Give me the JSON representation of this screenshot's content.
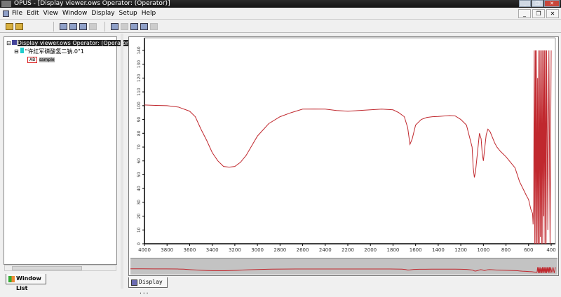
{
  "window": {
    "title": "OPUS - [Display viewer.ows     Operator:   (Operator)]"
  },
  "menu": [
    "File",
    "Edit",
    "View",
    "Window",
    "Display",
    "Setup",
    "Help"
  ],
  "tree": {
    "root": "Display viewer.ows     Operator:   (Operator)",
    "file": "\"许红军磷酸氢二钠.0\"1",
    "spectrum_label": "AB",
    "sample": "sample"
  },
  "left_tab": "Window List",
  "display_tab": "Display ...",
  "colors": {
    "spectrum": "#c0282e",
    "overview_bg": "#c3c3c3",
    "titlebar": "#1e1e1e"
  },
  "chart_data": {
    "type": "line",
    "xlim": [
      4000,
      400
    ],
    "ylim": [
      0,
      140
    ],
    "x_ticks": [
      "4000",
      "3800",
      "3600",
      "3400",
      "3200",
      "3000",
      "2800",
      "2600",
      "2400",
      "2200",
      "2000",
      "1800",
      "1600",
      "1400",
      "1200",
      "1000",
      "800",
      "600",
      "400"
    ],
    "y_ticks": [
      "0",
      "10",
      "20",
      "30",
      "40",
      "50",
      "60",
      "70",
      "80",
      "90",
      "100",
      "110",
      "120",
      "130",
      "140"
    ],
    "series": [
      {
        "x": [
          4000,
          3900,
          3800,
          3700,
          3600,
          3550,
          3500,
          3450,
          3400,
          3350,
          3300,
          3250,
          3200,
          3150,
          3100,
          3050,
          3000,
          2900,
          2800,
          2700,
          2600,
          2500,
          2400,
          2300,
          2200,
          2100,
          2000,
          1900,
          1800,
          1750,
          1700,
          1670,
          1650,
          1630,
          1600,
          1550,
          1500,
          1450,
          1400,
          1300,
          1250,
          1200,
          1150,
          1100,
          1090,
          1080,
          1070,
          1050,
          1035,
          1020,
          1010,
          1000,
          990,
          975,
          960,
          940,
          920,
          900,
          880,
          850,
          800,
          760,
          720,
          700,
          680,
          650,
          620,
          600,
          580,
          565,
          560,
          555,
          550,
          545,
          540,
          535,
          530,
          525,
          520,
          515,
          510,
          505,
          500,
          495,
          490,
          485,
          480,
          475,
          470,
          465,
          460,
          455,
          450,
          445,
          440,
          430,
          420,
          410,
          400
        ],
        "y": [
          100.5,
          100.2,
          100,
          99,
          96,
          92,
          83,
          75,
          66,
          60,
          56,
          55.5,
          56,
          59,
          64,
          71,
          78,
          87,
          92,
          95,
          97.5,
          97.6,
          97.5,
          96.5,
          96,
          96.5,
          97,
          97.5,
          97,
          95,
          92,
          84,
          72,
          76,
          86,
          90,
          91.5,
          92,
          92.2,
          92.8,
          92.6,
          90,
          86,
          70,
          55,
          48,
          52,
          68,
          80,
          76,
          65,
          60,
          68,
          79,
          83,
          81,
          77,
          73,
          70,
          67,
          63,
          59,
          55,
          50,
          45,
          40,
          35,
          32,
          25,
          22,
          14,
          28,
          140,
          0,
          140,
          0,
          140,
          0,
          120,
          0,
          140,
          0,
          140,
          5,
          140,
          0,
          140,
          0,
          140,
          20,
          140,
          0,
          140,
          0,
          140,
          10,
          140,
          0,
          140
        ]
      }
    ]
  }
}
